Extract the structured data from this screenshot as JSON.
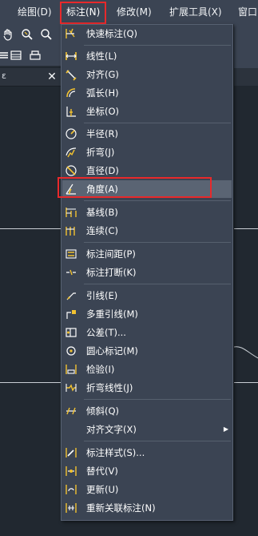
{
  "menubar": {
    "items": [
      {
        "label": "绘图(D)"
      },
      {
        "label": "标注(N)"
      },
      {
        "label": "修改(M)"
      },
      {
        "label": "扩展工具(X)"
      },
      {
        "label": "窗口"
      }
    ]
  },
  "dropdown": {
    "items": [
      {
        "label": "快速标注(Q)",
        "icon": "quick-dimension-icon"
      },
      {
        "label": "线性(L)",
        "icon": "linear-dimension-icon"
      },
      {
        "label": "对齐(G)",
        "icon": "aligned-dimension-icon"
      },
      {
        "label": "弧长(H)",
        "icon": "arc-length-icon"
      },
      {
        "label": "坐标(O)",
        "icon": "ordinate-icon"
      },
      {
        "label": "半径(R)",
        "icon": "radius-icon"
      },
      {
        "label": "折弯(J)",
        "icon": "jogged-icon"
      },
      {
        "label": "直径(D)",
        "icon": "diameter-icon"
      },
      {
        "label": "角度(A)",
        "icon": "angular-icon"
      },
      {
        "label": "基线(B)",
        "icon": "baseline-icon"
      },
      {
        "label": "连续(C)",
        "icon": "continue-icon"
      },
      {
        "label": "标注间距(P)",
        "icon": "dim-space-icon"
      },
      {
        "label": "标注打断(K)",
        "icon": "dim-break-icon"
      },
      {
        "label": "引线(E)",
        "icon": "leader-icon"
      },
      {
        "label": "多重引线(M)",
        "icon": "multileader-icon"
      },
      {
        "label": "公差(T)...",
        "icon": "tolerance-icon"
      },
      {
        "label": "圆心标记(M)",
        "icon": "center-mark-icon"
      },
      {
        "label": "检验(I)",
        "icon": "inspection-icon"
      },
      {
        "label": "折弯线性(J)",
        "icon": "jogged-linear-icon"
      },
      {
        "label": "倾斜(Q)",
        "icon": "oblique-icon"
      },
      {
        "label": "对齐文字(X)",
        "icon": "",
        "submenu_arrow": "▶"
      },
      {
        "label": "标注样式(S)...",
        "icon": "dim-style-icon"
      },
      {
        "label": "替代(V)",
        "icon": "override-icon"
      },
      {
        "label": "更新(U)",
        "icon": "update-icon"
      },
      {
        "label": "重新关联标注(N)",
        "icon": "reassociate-icon"
      }
    ]
  },
  "panel": {
    "close_label": "✕",
    "tab_label": "ε"
  },
  "colors": {
    "highlight_box": "#e8292b",
    "menu_bg": "#3b4453",
    "canvas_bg": "#212830",
    "icon_yellow": "#f2c230"
  }
}
